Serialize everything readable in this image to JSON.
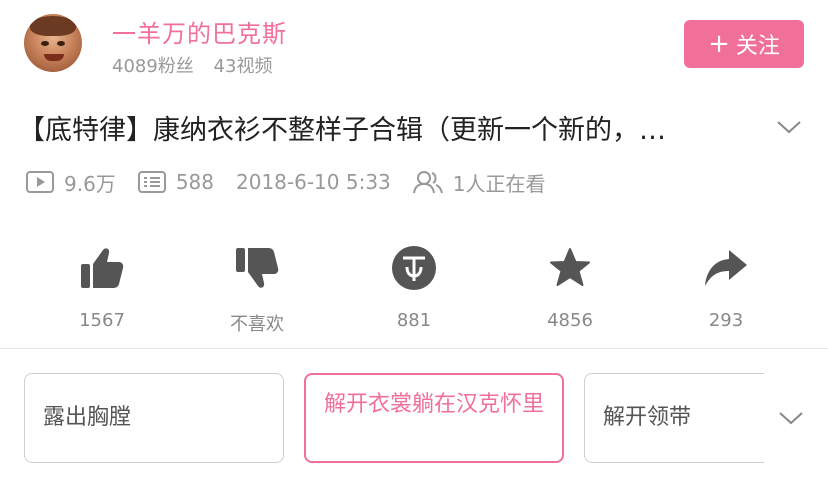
{
  "uploader": {
    "name": "一羊万的巴克斯",
    "followers": "4089粉丝",
    "videos": "43视频",
    "follow_plus": "+",
    "follow_label": "关注"
  },
  "video": {
    "title": "【底特律】康纳衣衫不整样子合辑（更新一个新的，…",
    "views": "9.6万",
    "danmaku": "588",
    "date": "2018-6-10 5:33",
    "watching": "1人正在看"
  },
  "actions": [
    {
      "icon": "thumbs-up-icon",
      "label": "1567"
    },
    {
      "icon": "thumbs-down-icon",
      "label": "不喜欢"
    },
    {
      "icon": "coin-icon",
      "label": "881"
    },
    {
      "icon": "star-icon",
      "label": "4856"
    },
    {
      "icon": "share-icon",
      "label": "293"
    }
  ],
  "tags": [
    {
      "label": "露出胸膛",
      "selected": false
    },
    {
      "label": "解开衣裳躺在汉克怀里",
      "selected": true
    },
    {
      "label": "解开领带",
      "selected": false
    }
  ],
  "colors": {
    "accent": "#f07099",
    "icon_gray": "#555555",
    "meta_gray": "#999999"
  }
}
